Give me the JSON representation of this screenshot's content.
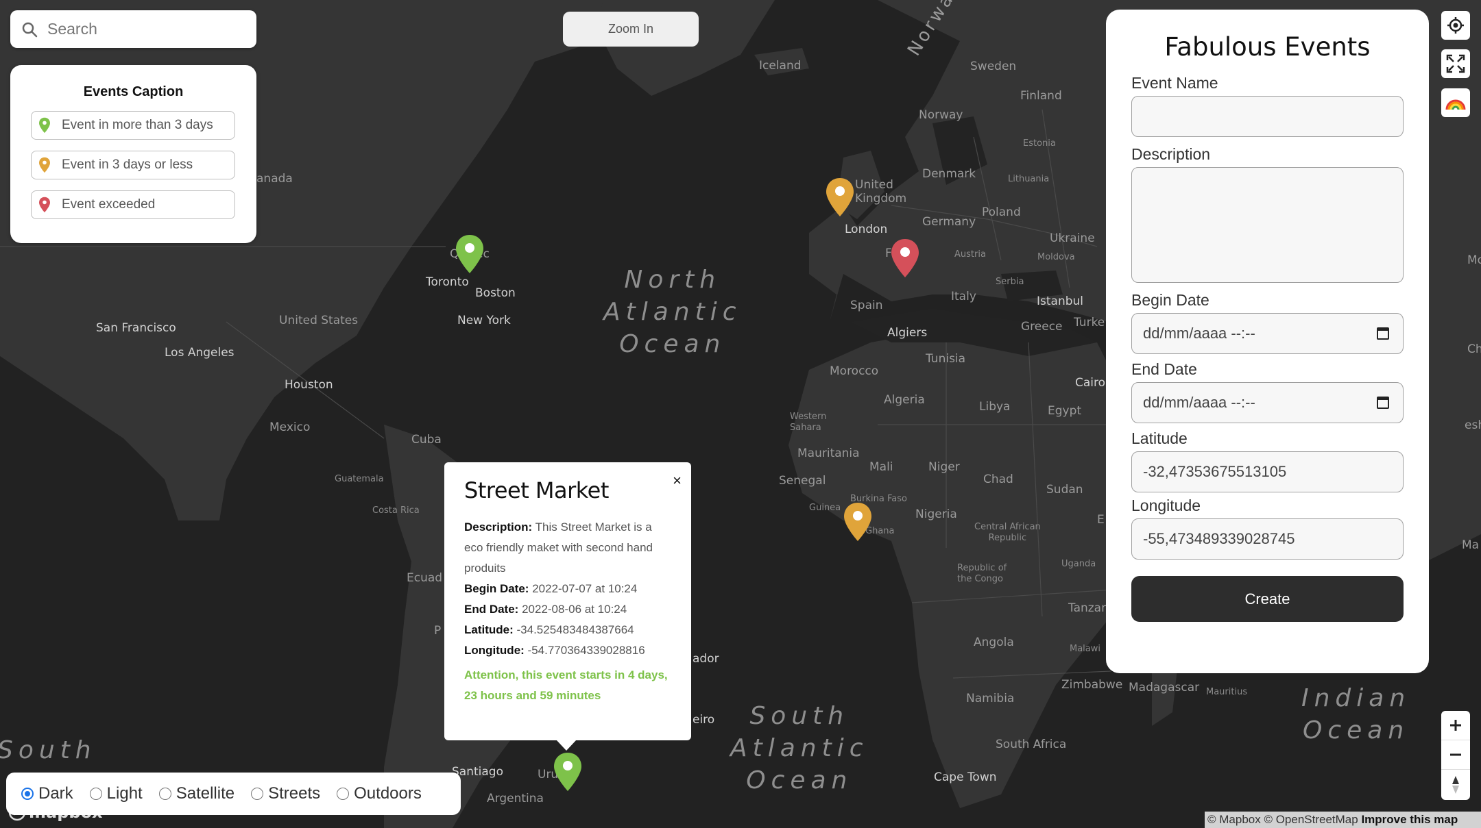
{
  "search": {
    "placeholder": "Search"
  },
  "zoom_button": {
    "label": "Zoom In"
  },
  "caption": {
    "title": "Events Caption",
    "items": [
      {
        "label": "Event in more than 3 days",
        "color": "#7ec24a"
      },
      {
        "label": "Event in 3 days or less",
        "color": "#e0a43a"
      },
      {
        "label": "Event exceeded",
        "color": "#d5505a"
      }
    ]
  },
  "form": {
    "title": "Fabulous Events",
    "event_name_label": "Event Name",
    "event_name_value": "",
    "description_label": "Description",
    "description_value": "",
    "begin_date_label": "Begin Date",
    "begin_date_value": "dd/mm/aaaa --:--",
    "end_date_label": "End Date",
    "end_date_value": "dd/mm/aaaa --:--",
    "latitude_label": "Latitude",
    "latitude_value": "-32,47353675513105",
    "longitude_label": "Longitude",
    "longitude_value": "-55,473489339028745",
    "create_label": "Create"
  },
  "popup": {
    "title": "Street Market",
    "close": "×",
    "description_key": "Description:",
    "description": "This Street Market is a eco friendly maket with second hand produits",
    "begin_key": "Begin Date:",
    "begin": "2022-07-07 at 10:24",
    "end_key": "End Date:",
    "end": "2022-08-06 at 10:24",
    "lat_key": "Latitude:",
    "lat": "-34.525483484387664",
    "lon_key": "Longitude:",
    "lon": "-54.770364339028816",
    "attention": "Attention, this event starts in 4 days, 23 hours and 59 minutes"
  },
  "map_styles": {
    "options": [
      "Dark",
      "Light",
      "Satellite",
      "Streets",
      "Outdoors"
    ],
    "selected": "Dark"
  },
  "map_labels": {
    "oceans": {
      "north_atlantic": "North\nAtlantic\nOcean",
      "south_atlantic": "South\nAtlantic\nOcean",
      "indian": "Indian\nOcean",
      "south": "South"
    },
    "places": [
      "Iceland",
      "Norway",
      "Sweden",
      "Finland",
      "Norway",
      "Estonia",
      "Lithuania",
      "Denmark",
      "United\nKingdom",
      "London",
      "Germany",
      "Poland",
      "Ukraine",
      "Moldova",
      "Austria",
      "Serbia",
      "Istanbul",
      "Turke",
      "Greece",
      "Italy",
      "Spain",
      "Algiers",
      "Tunisia",
      "Morocco",
      "Algeria",
      "Libya",
      "Egypt",
      "Cairo",
      "Western\nSahara",
      "Mauritania",
      "Mali",
      "Niger",
      "Chad",
      "Sudan",
      "Senegal",
      "Burkina Faso",
      "Guinea",
      "Ghana",
      "Nigeria",
      "Central African\nRepublic",
      "Republic of\nthe Congo",
      "Uganda",
      "Tanzan",
      "Angola",
      "Malawi",
      "Zimbabwe",
      "Namibia",
      "South Africa",
      "Cape Town",
      "Madagascar",
      "Mauritius",
      "anada",
      "Qu",
      "ec",
      "Toronto",
      "Boston",
      "New York",
      "San Francisco",
      "Los Angeles",
      "United States",
      "Houston",
      "Mexico",
      "Cuba",
      "Guatemala",
      "Costa Rica",
      "Ecuad",
      "Santiago",
      "Argentina",
      "Uru",
      "ador",
      "eiro",
      "Mo",
      "Ch",
      "esh",
      "Ma",
      "E",
      "F",
      "P"
    ]
  },
  "attribution": {
    "text": "© Mapbox © OpenStreetMap",
    "improve": "Improve this map"
  },
  "logo": "mapbox"
}
